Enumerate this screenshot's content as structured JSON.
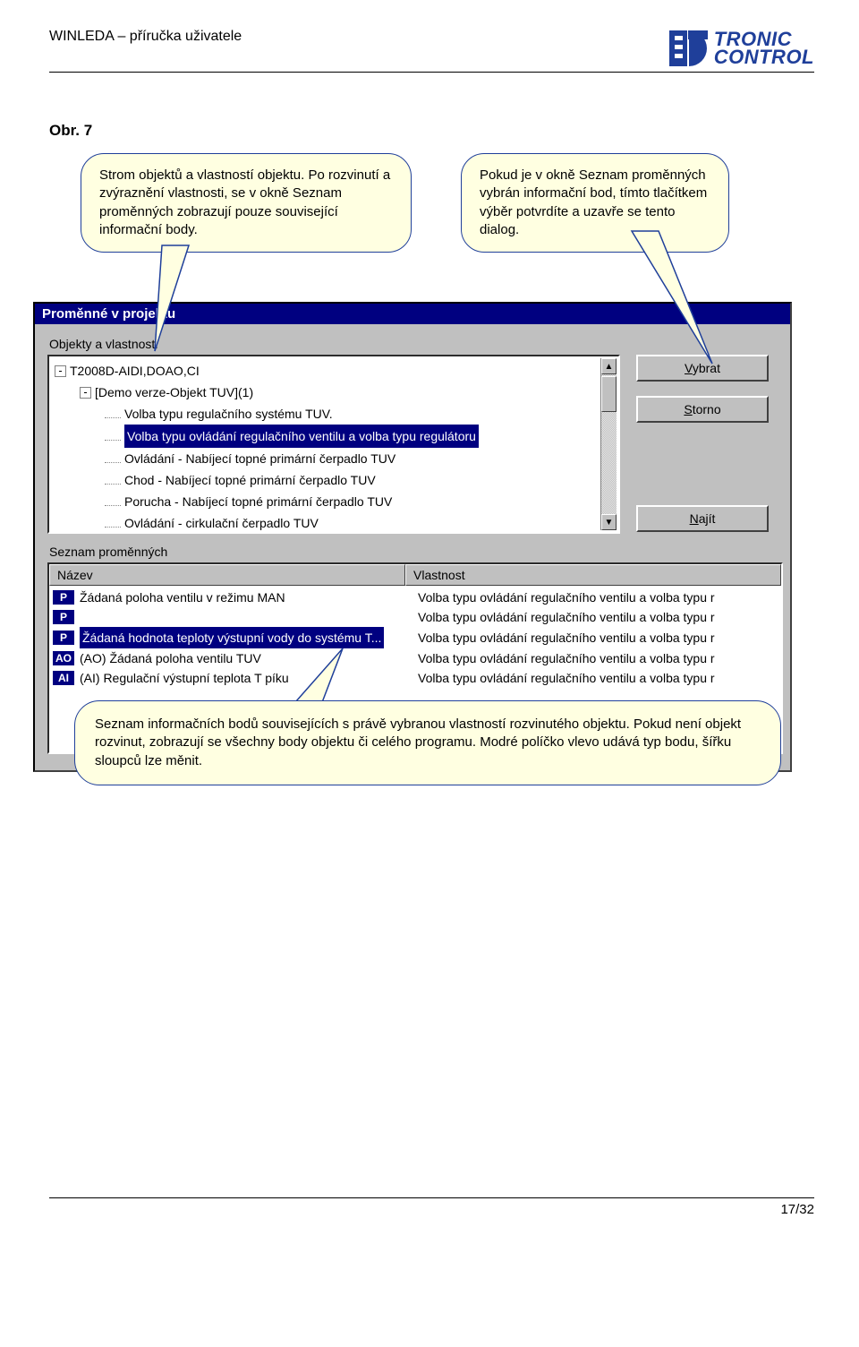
{
  "header": {
    "title": "WINLEDA – příručka uživatele"
  },
  "logo": {
    "line1": "TRONIC",
    "line2": "CONTROL"
  },
  "figure_label": "Obr. 7",
  "callouts": {
    "left": "Strom objektů a vlastností objektu. Po rozvinutí a zvýraznění  vlastnosti, se v okně Seznam proměnných zobrazují pouze související informační body.",
    "right": "Pokud je v okně Seznam proměnných vybrán informační bod, tímto tlačítkem výběr potvrdíte a uzavře se tento dialog.",
    "bottom": "Seznam informačních bodů souvisejících s právě vybranou vlastností rozvinutého objektu. Pokud není objekt rozvinut, zobrazují se všechny body objektu či celého programu. Modré políčko vlevo udává typ bodu,  šířku sloupců lze měnit."
  },
  "dialog": {
    "title": "Proměnné v projektu",
    "section_tree": "Objekty a vlastnosti",
    "buttons": {
      "select": "Vybrat",
      "cancel": "Storno",
      "find": "Najít"
    },
    "tree": [
      {
        "indent": 0,
        "glyph": "-",
        "text": "T2008D-AIDI,DOAO,CI"
      },
      {
        "indent": 1,
        "glyph": "-",
        "text": "[Demo verze-Objekt TUV](1)"
      },
      {
        "indent": 2,
        "glyph": "",
        "text": "Volba typu regulačního systému TUV."
      },
      {
        "indent": 2,
        "glyph": "",
        "text": "Volba typu ovládání regulačního ventilu a volba typu regulátoru",
        "selected": true
      },
      {
        "indent": 2,
        "glyph": "",
        "text": "Ovládání - Nabíjecí topné primární čerpadlo TUV"
      },
      {
        "indent": 2,
        "glyph": "",
        "text": "Chod - Nabíjecí topné primární čerpadlo TUV"
      },
      {
        "indent": 2,
        "glyph": "",
        "text": "Porucha - Nabíjecí topné primární čerpadlo TUV"
      },
      {
        "indent": 2,
        "glyph": "",
        "text": "Ovládání - cirkulační čerpadlo TUV"
      }
    ],
    "section_list": "Seznam proměnných",
    "columns": {
      "name": "Název",
      "prop": "Vlastnost"
    },
    "rows": [
      {
        "badge": "P",
        "name": "Žádaná poloha ventilu v režimu MAN",
        "prop": "Volba typu ovládání regulačního ventilu a volba typu r"
      },
      {
        "badge": "P",
        "name": "",
        "prop": "Volba typu ovládání regulačního ventilu a volba typu r"
      },
      {
        "badge": "P",
        "name": "Žádaná hodnota teploty výstupní vody do systému T...",
        "prop": "Volba typu ovládání regulačního ventilu a volba typu r",
        "selected": true
      },
      {
        "badge": "AO",
        "name": "(AO) Žádaná poloha ventilu TUV",
        "prop": "Volba typu ovládání regulačního ventilu a volba typu r"
      },
      {
        "badge": "AI",
        "name": "(AI) Regulační výstupní teplota T              píku",
        "prop": "Volba typu ovládání regulačního ventilu a volba typu r"
      }
    ]
  },
  "footer": {
    "page": "17/32"
  }
}
